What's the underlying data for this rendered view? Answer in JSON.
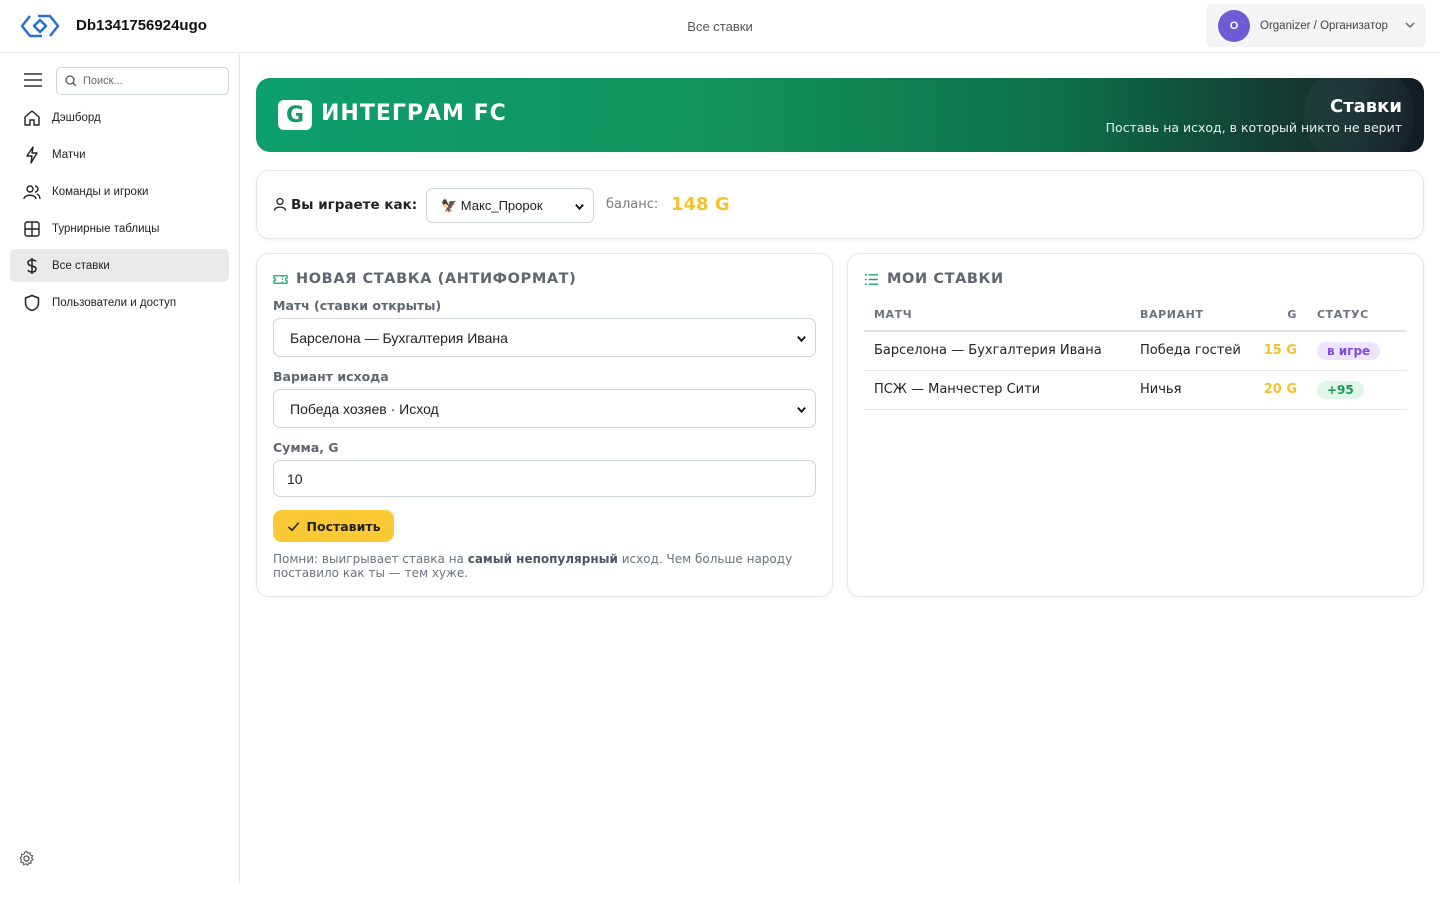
{
  "header": {
    "app_title": "Db1341756924ugo",
    "page_heading": "Все ставки",
    "user": {
      "initial": "O",
      "name": "Organizer / Организатор"
    }
  },
  "sidebar": {
    "search_placeholder": "Поиск...",
    "items": [
      {
        "label": "Дэшборд",
        "icon": "home-icon",
        "active": false
      },
      {
        "label": "Матчи",
        "icon": "lightning-icon",
        "active": false
      },
      {
        "label": "Команды и игроки",
        "icon": "users-icon",
        "active": false
      },
      {
        "label": "Турнирные таблицы",
        "icon": "table-icon",
        "active": false
      },
      {
        "label": "Все ставки",
        "icon": "dollar-icon",
        "active": true
      },
      {
        "label": "Пользователи и доступ",
        "icon": "shield-icon",
        "active": false
      }
    ]
  },
  "banner": {
    "badge": "G",
    "brand": "ИНТЕГРАМ FC",
    "title": "Ставки",
    "subtitle": "Поставь на исход, в который никто не верит"
  },
  "player": {
    "label": "Вы играете как:",
    "selected": "🦅 Макс_Пророк",
    "balance_label": "баланс:",
    "balance_value": "148 G"
  },
  "new_bet": {
    "title": "НОВАЯ СТАВКА (АНТИФОРМАТ)",
    "match_label": "Матч (ставки открыты)",
    "match_value": "Барселона — Бухгалтерия Ивана",
    "outcome_label": "Вариант исхода",
    "outcome_value": "Победа хозяев · Исход",
    "amount_label": "Сумма, G",
    "amount_value": "10",
    "submit_label": "Поставить",
    "hint_pre": "Помни: выигрывает ставка на ",
    "hint_bold": "самый непопулярный",
    "hint_post": " исход. Чем больше народу поставило как ты — тем хуже."
  },
  "my_bets": {
    "title": "МОИ СТАВКИ",
    "columns": [
      "МАТЧ",
      "ВАРИАНТ",
      "G",
      "СТАТУС"
    ],
    "rows": [
      {
        "match": "Барселона — Бухгалтерия Ивана",
        "variant": "Победа гостей",
        "amount": "15 G",
        "status": "в игре"
      },
      {
        "match": "ПСЖ — Манчестер Сити",
        "variant": "Ничья",
        "amount": "20 G",
        "status": "+95"
      }
    ]
  },
  "colors": {
    "accent_green": "#0d9f6c",
    "gold": "#f6c22c",
    "button_yellow": "#fbc935",
    "avatar_purple": "#6f5bd3"
  }
}
